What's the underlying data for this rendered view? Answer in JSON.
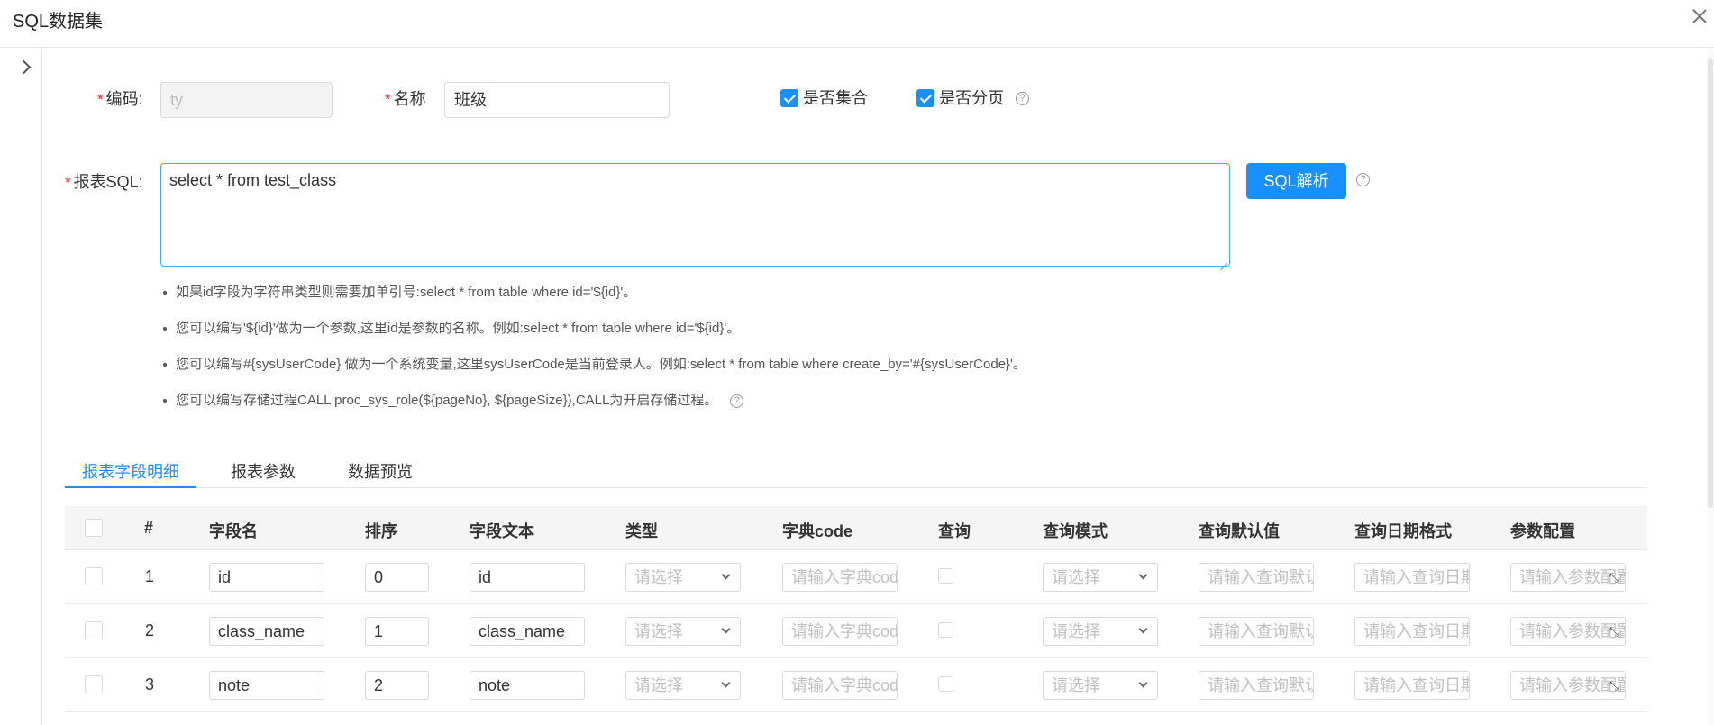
{
  "header": {
    "title": "SQL数据集"
  },
  "form": {
    "code": {
      "label": "编码:",
      "value": "ty"
    },
    "name": {
      "label": "名称",
      "value": "班级"
    },
    "is_collection": {
      "label": "是否集合",
      "checked": true
    },
    "is_paged": {
      "label": "是否分页",
      "checked": true
    },
    "sql": {
      "label": "报表SQL:",
      "value": "select * from test_class"
    },
    "parse_button": "SQL解析",
    "tips": [
      "如果id字段为字符串类型则需要加单引号:select * from table where id='${id}'。",
      "您可以编写'${id}'做为一个参数,这里id是参数的名称。例如:select * from table where id='${id}'。",
      "您可以编写#{sysUserCode} 做为一个系统变量,这里sysUserCode是当前登录人。例如:select * from table where create_by='#{sysUserCode}'。",
      "您可以编写存储过程CALL proc_sys_role(${pageNo}, ${pageSize}),CALL为开启存储过程。"
    ],
    "help_glyph": "?"
  },
  "tabs": [
    {
      "label": "报表字段明细",
      "active": true
    },
    {
      "label": "报表参数",
      "active": false
    },
    {
      "label": "数据预览",
      "active": false
    }
  ],
  "table": {
    "columns": [
      "#",
      "字段名",
      "排序",
      "字段文本",
      "类型",
      "字典code",
      "查询",
      "查询模式",
      "查询默认值",
      "查询日期格式",
      "参数配置"
    ],
    "placeholders": {
      "type": "请选择",
      "dict_code": "请输入字典code",
      "query_mode": "请选择",
      "query_default": "请输入查询默认值",
      "date_format": "请输入查询日期格式",
      "param_config": "请输入参数配置"
    },
    "rows": [
      {
        "index": "1",
        "field_name": "id",
        "order": "0",
        "field_text": "id"
      },
      {
        "index": "2",
        "field_name": "class_name",
        "order": "1",
        "field_text": "class_name"
      },
      {
        "index": "3",
        "field_name": "note",
        "order": "2",
        "field_text": "note"
      }
    ]
  },
  "colors": {
    "primary": "#1890ff",
    "required": "#f5222d"
  }
}
